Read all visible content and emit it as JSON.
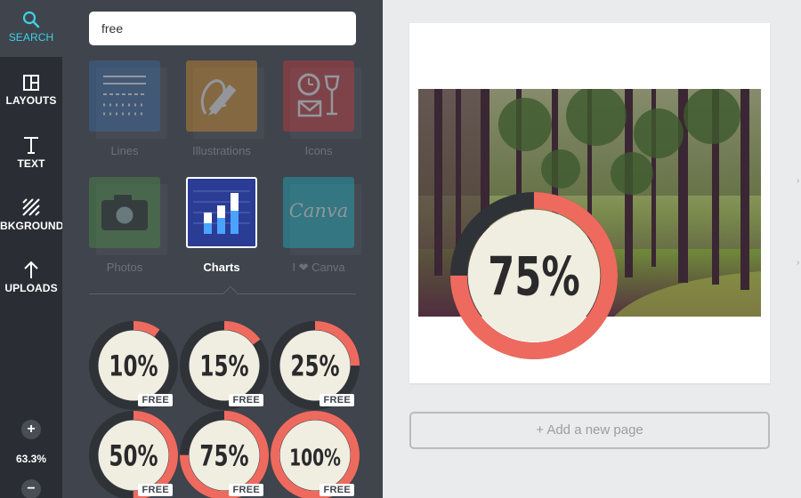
{
  "rail": {
    "items": [
      {
        "label": "SEARCH",
        "icon": "search-icon"
      },
      {
        "label": "LAYOUTS",
        "icon": "layouts-icon"
      },
      {
        "label": "TEXT",
        "icon": "text-icon"
      },
      {
        "label": "BKGROUND",
        "icon": "background-icon"
      },
      {
        "label": "UPLOADS",
        "icon": "upload-icon"
      }
    ],
    "zoom_in": "+",
    "zoom_level": "63.3%",
    "zoom_out": "−"
  },
  "search": {
    "value": "free",
    "placeholder": ""
  },
  "categories": [
    {
      "label": "Lines"
    },
    {
      "label": "Illustrations"
    },
    {
      "label": "Icons"
    },
    {
      "label": "Photos"
    },
    {
      "label": "Charts"
    },
    {
      "label": "I ❤ Canva"
    }
  ],
  "canva_logo_text": "Canva",
  "charts": [
    {
      "percent": 10,
      "label": "10%",
      "badge": "FREE"
    },
    {
      "percent": 15,
      "label": "15%",
      "badge": "FREE"
    },
    {
      "percent": 25,
      "label": "25%",
      "badge": "FREE"
    },
    {
      "percent": 50,
      "label": "50%",
      "badge": "FREE"
    },
    {
      "percent": 75,
      "label": "75%",
      "badge": "FREE"
    },
    {
      "percent": 100,
      "label": "100%",
      "badge": "FREE"
    }
  ],
  "canvas": {
    "chart_percent": 75,
    "chart_label": "75%"
  },
  "add_page_label": "+ Add a new page",
  "colors": {
    "accent": "#3fd1e6",
    "ring": "#ef6a5e",
    "ring_track": "#2f3237",
    "ring_fill": "#f0ede1",
    "panel": "#3f444d",
    "rail": "#2a2d33"
  }
}
